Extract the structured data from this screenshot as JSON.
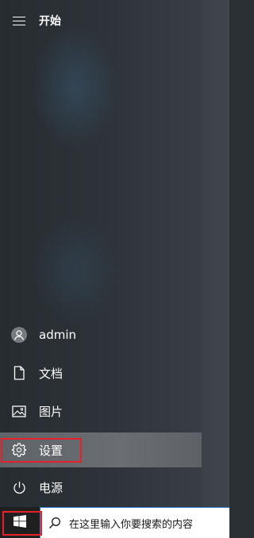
{
  "start_menu": {
    "title": "开始",
    "user": {
      "name": "admin",
      "icon": "user-avatar-icon"
    },
    "items": [
      {
        "label": "文档",
        "icon": "document-icon"
      },
      {
        "label": "图片",
        "icon": "picture-icon"
      },
      {
        "label": "设置",
        "icon": "gear-icon",
        "active": true
      },
      {
        "label": "电源",
        "icon": "power-icon"
      }
    ]
  },
  "taskbar": {
    "start_icon": "windows-logo-icon",
    "search_placeholder": "在这里输入你要搜索的内容",
    "search_icon": "search-icon"
  },
  "colors": {
    "highlight_border": "#e8202a",
    "search_border": "#2f7fd6",
    "active_item_bg": "#65696d"
  }
}
